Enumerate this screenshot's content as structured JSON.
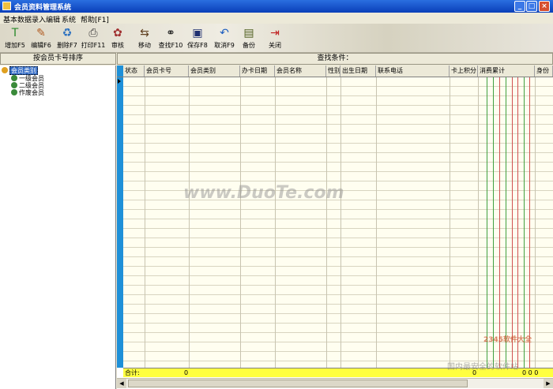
{
  "window": {
    "title": "会员资料管理系统",
    "min": "_",
    "max": "□",
    "close": "×"
  },
  "menu": [
    "基本数据录入编辑",
    "系统",
    "帮助[F1]"
  ],
  "toolbar": [
    {
      "label": "增加F5",
      "icon": "add-doc-icon",
      "glyph": "T",
      "color": "#2a8a2a"
    },
    {
      "label": "编辑F6",
      "icon": "edit-pencil-icon",
      "glyph": "✎",
      "color": "#b05a20"
    },
    {
      "label": "删除F7",
      "icon": "delete-recycle-icon",
      "glyph": "♻",
      "color": "#2a70c0"
    },
    {
      "label": "打印F11",
      "icon": "print-icon",
      "glyph": "⎙",
      "color": "#404040"
    },
    {
      "label": "审核",
      "icon": "audit-icon",
      "glyph": "✿",
      "color": "#a03030"
    },
    {
      "label": "移动",
      "icon": "move-icon",
      "glyph": "⇆",
      "color": "#604020"
    },
    {
      "label": "查找F10",
      "icon": "binoculars-icon",
      "glyph": "⚭",
      "color": "#202020"
    },
    {
      "label": "保存F8",
      "icon": "save-disk-icon",
      "glyph": "▣",
      "color": "#203070"
    },
    {
      "label": "取消F9",
      "icon": "undo-arrow-icon",
      "glyph": "↶",
      "color": "#2060c0"
    },
    {
      "label": "备份",
      "icon": "backup-icon",
      "glyph": "▤",
      "color": "#506020"
    },
    {
      "label": "关闭",
      "icon": "exit-door-icon",
      "glyph": "⇥",
      "color": "#c02020"
    }
  ],
  "sort_button": "按会员卡号排序",
  "search_label": "查找条件：",
  "tree": {
    "root": "会员类别",
    "children": [
      "一级会员",
      "二级会员",
      "作废会员"
    ]
  },
  "grid": {
    "columns": [
      "状态",
      "会员卡号",
      "会员类别",
      "办卡日期",
      "会员名称",
      "性别",
      "出生日期",
      "联系电话",
      "卡上积分",
      "消费累计",
      "身份"
    ],
    "summary": {
      "label": "合计:",
      "card_total": "0",
      "points_total": "0",
      "tail": "0 0 0"
    }
  },
  "watermark": "www.DuoTe.com",
  "watermark2": "2345软件大全",
  "watermark3": "国内最安全的软件站"
}
